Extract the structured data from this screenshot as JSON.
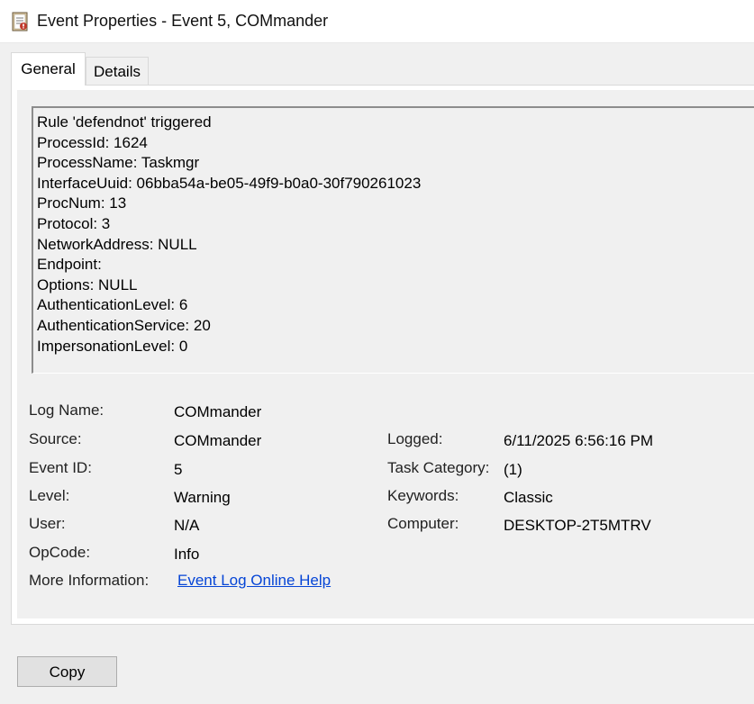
{
  "window": {
    "title": "Event Properties - Event 5, COMmander",
    "icon": "event-viewer-icon"
  },
  "tabs": [
    {
      "label": "General",
      "active": true
    },
    {
      "label": "Details",
      "active": false
    }
  ],
  "description": "Rule 'defendnot' triggered\nProcessId: 1624\nProcessName: Taskmgr\nInterfaceUuid: 06bba54a-be05-49f9-b0a0-30f790261023\nProcNum: 13\nProtocol: 3\nNetworkAddress: NULL\nEndpoint:\nOptions: NULL\nAuthenticationLevel: 6\nAuthenticationService: 20\nImpersonationLevel: 0",
  "fields": {
    "log_name": {
      "label": "Log Name:",
      "value": "COMmander"
    },
    "source": {
      "label": "Source:",
      "value": "COMmander"
    },
    "event_id": {
      "label": "Event ID:",
      "value": "5"
    },
    "level": {
      "label": "Level:",
      "value": "Warning"
    },
    "user": {
      "label": "User:",
      "value": "N/A"
    },
    "opcode": {
      "label": "OpCode:",
      "value": "Info"
    },
    "more_info": {
      "label": "More Information:",
      "link": "Event Log Online Help"
    },
    "logged": {
      "label": "Logged:",
      "value": "6/11/2025 6:56:16 PM"
    },
    "task_category": {
      "label": "Task Category:",
      "value": "(1)"
    },
    "keywords": {
      "label": "Keywords:",
      "value": "Classic"
    },
    "computer": {
      "label": "Computer:",
      "value": "DESKTOP-2T5MTRV"
    }
  },
  "buttons": {
    "copy": "Copy"
  },
  "colors": {
    "link": "#0645d6",
    "background": "#f0f0f0"
  }
}
